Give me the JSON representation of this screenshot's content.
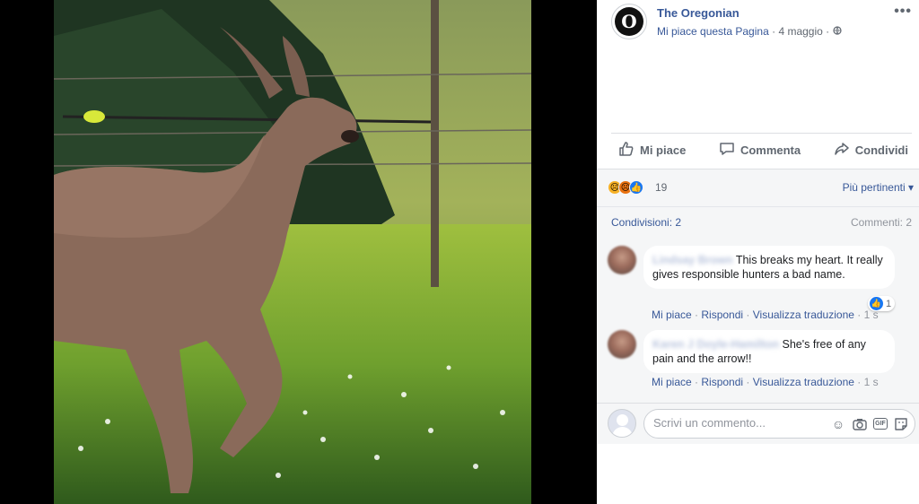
{
  "post": {
    "page_name": "The Oregonian",
    "page_logo_letter": "O",
    "like_page": "Mi piace questa Pagina",
    "separator": "·",
    "date": "4 maggio",
    "more": "•••"
  },
  "actions": {
    "like": "Mi piace",
    "comment": "Commenta",
    "share": "Condividi"
  },
  "reactions": {
    "count": "19",
    "sort": "Più pertinenti",
    "types": [
      "sad-icon",
      "angry-icon",
      "like-icon"
    ]
  },
  "stats": {
    "shares": "Condivisioni: 2",
    "comments": "Commenti: 2"
  },
  "comments": [
    {
      "author": "Lindsay Brown",
      "text": "This breaks my heart. It really gives responsible hunters a bad name.",
      "like": "Mi piace",
      "reply": "Rispondi",
      "translate": "Visualizza traduzione",
      "time": "1 s",
      "likes": "1"
    },
    {
      "author": "Karen J Doyle-Hamilton",
      "text": "She's free of any pain and the arrow!!",
      "like": "Mi piace",
      "reply": "Rispondi",
      "translate": "Visualizza traduzione",
      "time": "1 s"
    }
  ],
  "composer": {
    "placeholder": "Scrivi un commento..."
  },
  "colors": {
    "link": "#385898",
    "brand": "#1877f2",
    "muted": "#606770"
  }
}
